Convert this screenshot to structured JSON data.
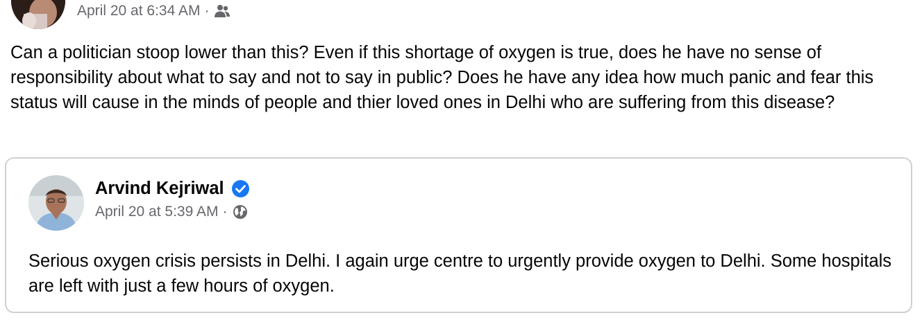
{
  "post": {
    "timestamp": "April 20 at 6:34 AM",
    "separator": "·",
    "audience_icon": "friends-icon",
    "more_icon": "more-options-icon",
    "text": "Can a politician stoop lower than this? Even if this shortage of oxygen is true, does he have no sense of responsibility about what to say and not to say in public? Does he have any idea how much panic and fear this status will cause in the minds of people and thier loved ones in Delhi who are suffering from this disease?"
  },
  "shared_post": {
    "author_name": "Arvind Kejriwal",
    "verified_icon": "verified-badge-icon",
    "timestamp": "April 20 at 5:39 AM",
    "separator": "·",
    "audience_icon": "globe-icon",
    "text": "Serious oxygen crisis persists in Delhi. I again urge centre to urgently provide oxygen to Delhi. Some hospitals are left with just a few hours of oxygen."
  },
  "colors": {
    "text_primary": "#050505",
    "text_secondary": "#65676b",
    "card_border": "#ced0d4",
    "verified_blue": "#1877f2"
  }
}
